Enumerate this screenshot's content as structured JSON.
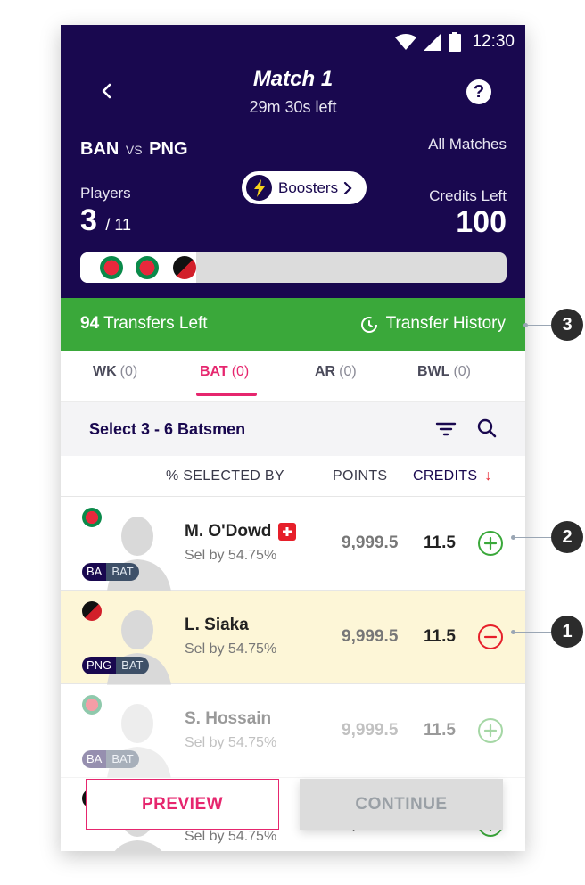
{
  "status_bar": {
    "time": "12:30"
  },
  "header": {
    "title": "Match 1",
    "subtitle": "29m 30s left",
    "team1": "BAN",
    "vs": "VS",
    "team2": "PNG",
    "all_matches": "All Matches",
    "players_label": "Players",
    "players_count": "3",
    "players_total": "/ 11",
    "boosters_label": "Boosters",
    "credits_label": "Credits Left",
    "credits_value": "100",
    "selected_flags": [
      "bangladesh-flag",
      "bangladesh-flag",
      "png-flag"
    ],
    "selection_fraction": 0.2727
  },
  "transfers": {
    "count": "94",
    "label": "Transfers Left",
    "history_label": "Transfer History"
  },
  "tabs": [
    {
      "label": "WK",
      "count": "(0)",
      "active": false
    },
    {
      "label": "BAT",
      "count": "(0)",
      "active": true
    },
    {
      "label": "AR",
      "count": "(0)",
      "active": false
    },
    {
      "label": "BWL",
      "count": "(0)",
      "active": false
    }
  ],
  "list": {
    "title": "Select 3 - 6 Batsmen",
    "col_selected": "% SELECTED BY",
    "col_points": "POINTS",
    "col_credits": "CREDITS",
    "sort_arrow": "↓"
  },
  "players": [
    {
      "name": "M. O'Dowd",
      "sel": "Sel by 54.75%",
      "points": "9,999.5",
      "credits": "11.5",
      "team": "BA",
      "role": "BAT",
      "state": "add",
      "injury": true
    },
    {
      "name": "L. Siaka",
      "sel": "Sel by 54.75%",
      "points": "9,999.5",
      "credits": "11.5",
      "team": "PNG",
      "role": "BAT",
      "state": "remove",
      "injury": false
    },
    {
      "name": "S. Hossain",
      "sel": "Sel by 54.75%",
      "points": "9,999.5",
      "credits": "11.5",
      "team": "BA",
      "role": "BAT",
      "state": "add",
      "injury": false
    },
    {
      "name": "",
      "sel": "Sel by 54.75%",
      "points": "9,999.5",
      "credits": "11.5",
      "team": "",
      "role": "",
      "state": "add",
      "injury": false
    }
  ],
  "buttons": {
    "preview": "PREVIEW",
    "continue": "CONTINUE"
  },
  "callouts": [
    "1",
    "2",
    "3"
  ],
  "colors": {
    "header_bg": "#19084f",
    "accent_pink": "#e6266e",
    "green": "#3aa83a",
    "red": "#e61f2a",
    "selected_row_bg": "#fdf6d7"
  }
}
